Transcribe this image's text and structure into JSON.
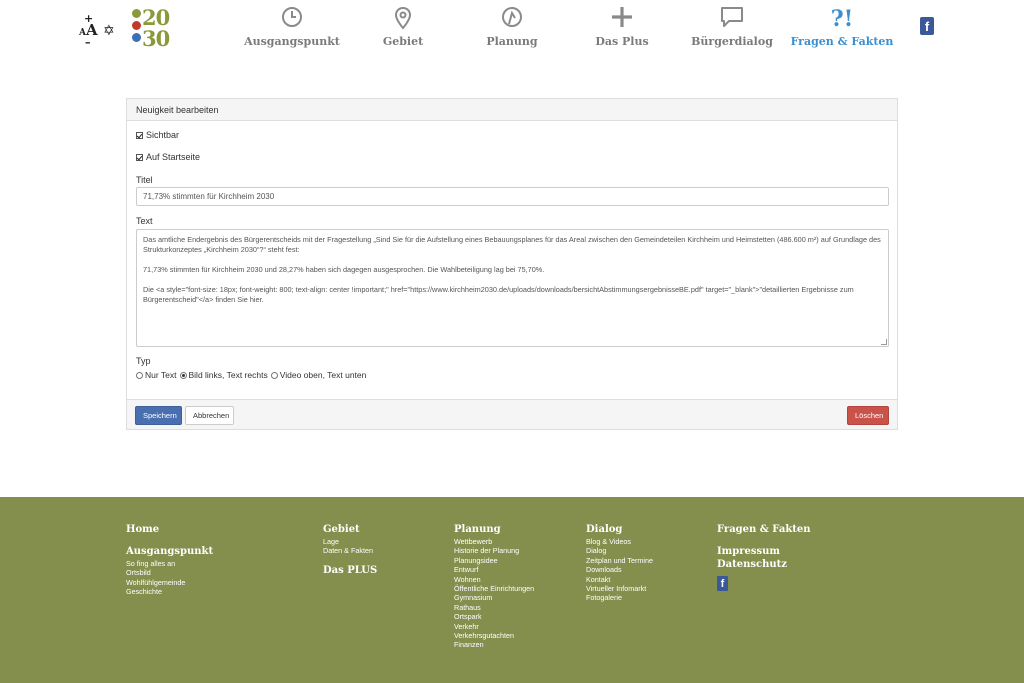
{
  "nav": {
    "items": [
      {
        "label": "Ausgangspunkt",
        "icon": "clock-icon"
      },
      {
        "label": "Gebiet",
        "icon": "map-pin-icon"
      },
      {
        "label": "Planung",
        "icon": "compass-icon"
      },
      {
        "label": "Das Plus",
        "icon": "plus-icon"
      },
      {
        "label": "Bürgerdialog",
        "icon": "speech-bubble-icon"
      },
      {
        "label": "Fragen & Fakten",
        "icon": "question-exclamation-icon",
        "glyph": "?!"
      }
    ],
    "active": "Fragen & Fakten",
    "active_color": "#3b8fd0"
  },
  "logo": {
    "top": "20",
    "bottom": "30"
  },
  "form": {
    "heading": "Neuigkeit bearbeiten",
    "visible_label": "Sichtbar",
    "startpage_label": "Auf Startseite",
    "title_label": "Titel",
    "title_value": "71,73% stimmten für Kirchheim 2030",
    "text_label": "Text",
    "text_paragraphs": [
      "Das amtliche Endergebnis des Bürgerentscheids mit der Fragestellung „Sind Sie für die Aufstellung eines Bebauungsplanes für das Areal zwischen den Gemeindeteilen Kirchheim und Heimstetten (486.600 m²) auf Grundlage des Strukturkonzeptes „Kirchheim 2030“?“ steht fest:",
      "71,73% stimmten für Kirchheim 2030 und 28,27% haben sich dagegen ausgesprochen. Die Wahlbeteiligung lag bei 75,70%.",
      "Die <a style=\"font-size: 18px; font-weight: 800; text-align: center !important;\" href=\"https://www.kirchheim2030.de/uploads/downloads/bersichtAbstimmungsergebnisseBE.pdf\" target=\"_blank\">\"detaillierten Ergebnisse zum Bürgerentscheid\"</a> finden Sie hier."
    ],
    "type_label": "Typ",
    "type_options": [
      "Nur Text",
      "Bild links, Text rechts",
      "Video oben, Text unten"
    ],
    "type_selected": "Bild links, Text rechts",
    "save_label": "Speichern",
    "cancel_label": "Abbrechen",
    "delete_label": "Löschen"
  },
  "footer": {
    "bg_color": "#848f4d",
    "home": "Home",
    "ausgangspunkt": {
      "title": "Ausgangspunkt",
      "links": [
        "So fing alles an",
        "Ortsbild",
        "Wohlfühlgemeinde",
        "Geschichte"
      ]
    },
    "gebiet": {
      "title": "Gebiet",
      "links": [
        "Lage",
        "Daten & Fakten"
      ]
    },
    "das_plus": "Das PLUS",
    "planung": {
      "title": "Planung",
      "links": [
        "Wettbewerb",
        "Historie der Planung",
        "Planungsidee",
        "Entwurf",
        "Wohnen",
        "Öffentliche Einrichtungen",
        "Gymnasium",
        "Rathaus",
        "Ortspark",
        "Verkehr",
        "Verkehrsgutachten",
        "Finanzen"
      ]
    },
    "dialog": {
      "title": "Dialog",
      "links": [
        "Blog & Videos",
        "Dialog",
        "Zeitplan und Termine",
        "Downloads",
        "Kontakt",
        "Virtueller Infomarkt",
        "Fotogalerie"
      ]
    },
    "fragen": "Fragen & Fakten",
    "impressum": "Impressum",
    "datenschutz": "Datenschutz"
  }
}
